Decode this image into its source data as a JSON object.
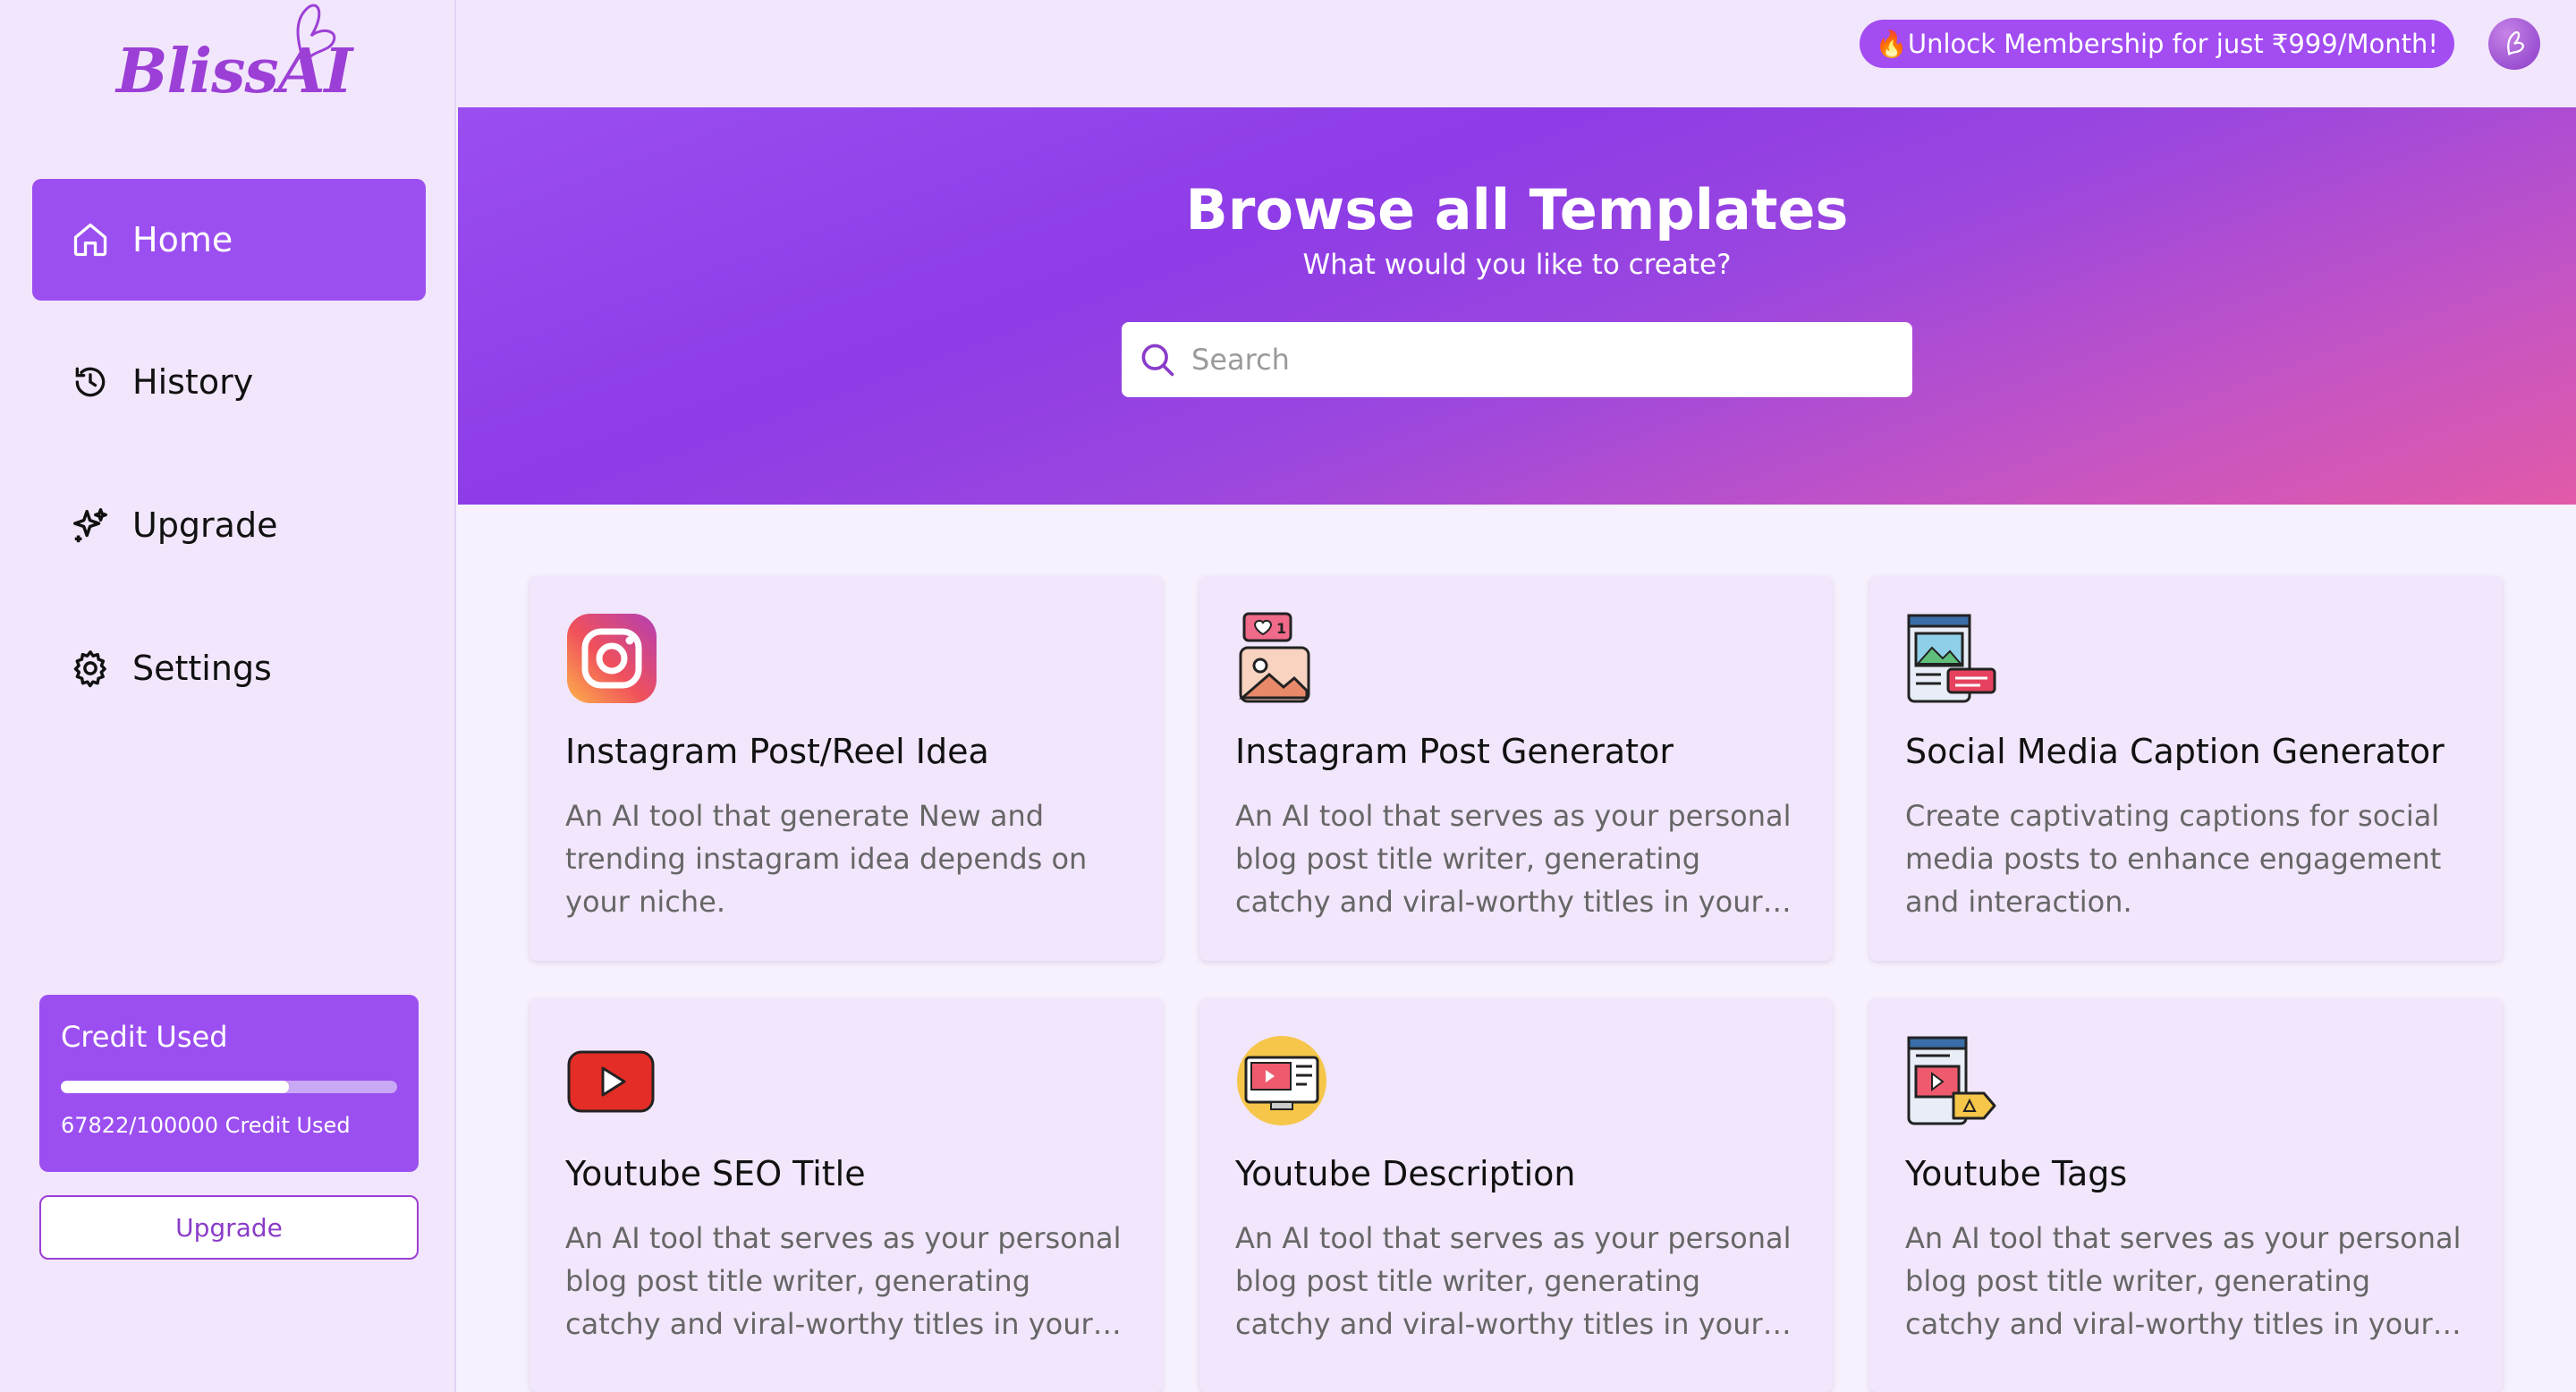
{
  "brand": {
    "name": "BlissAI"
  },
  "sidebar": {
    "items": [
      {
        "label": "Home",
        "icon": "home-icon",
        "active": true
      },
      {
        "label": "History",
        "icon": "history-icon",
        "active": false
      },
      {
        "label": "Upgrade",
        "icon": "sparkle-icon",
        "active": false
      },
      {
        "label": "Settings",
        "icon": "gear-icon",
        "active": false
      }
    ],
    "credit": {
      "title": "Credit Used",
      "used": 67822,
      "total": 100000,
      "fraction": 0.678,
      "text": "67822/100000 Credit Used"
    },
    "upgrade_label": "Upgrade"
  },
  "topbar": {
    "promo": "🔥Unlock Membership for just ₹999/Month!",
    "avatar_icon": "butterfly-avatar-icon"
  },
  "hero": {
    "title": "Browse all Templates",
    "subtitle": "What would you like to create?",
    "search_placeholder": "Search"
  },
  "cards": [
    {
      "title": "Instagram Post/Reel Idea",
      "desc": "An AI tool that generate New and trending instagram idea depends on your niche.",
      "icon": "instagram-icon"
    },
    {
      "title": "Instagram Post Generator",
      "desc": "An AI tool that serves as your personal blog post title writer, generating catchy and viral-worthy titles in your chosen topic.",
      "icon": "post-image-icon"
    },
    {
      "title": "Social Media Caption Generator",
      "desc": "Create captivating captions for social media posts to enhance engagement and interaction.",
      "icon": "caption-icon"
    },
    {
      "title": "Youtube SEO Title",
      "desc": "An AI tool that serves as your personal blog post title writer, generating catchy and viral-worthy titles in your chosen topic.",
      "icon": "youtube-icon"
    },
    {
      "title": "Youtube Description",
      "desc": "An AI tool that serves as your personal blog post title writer, generating catchy and viral-worthy titles in your chosen topic.",
      "icon": "video-description-icon"
    },
    {
      "title": "Youtube Tags",
      "desc": "An AI tool that serves as your personal blog post title writer, generating catchy and viral-worthy titles in your chosen topic.",
      "icon": "video-tag-icon"
    }
  ],
  "colors": {
    "accent": "#9c4ff0",
    "sidebar_bg": "#f1e6fb",
    "card_bg": "#f1e6fb"
  }
}
